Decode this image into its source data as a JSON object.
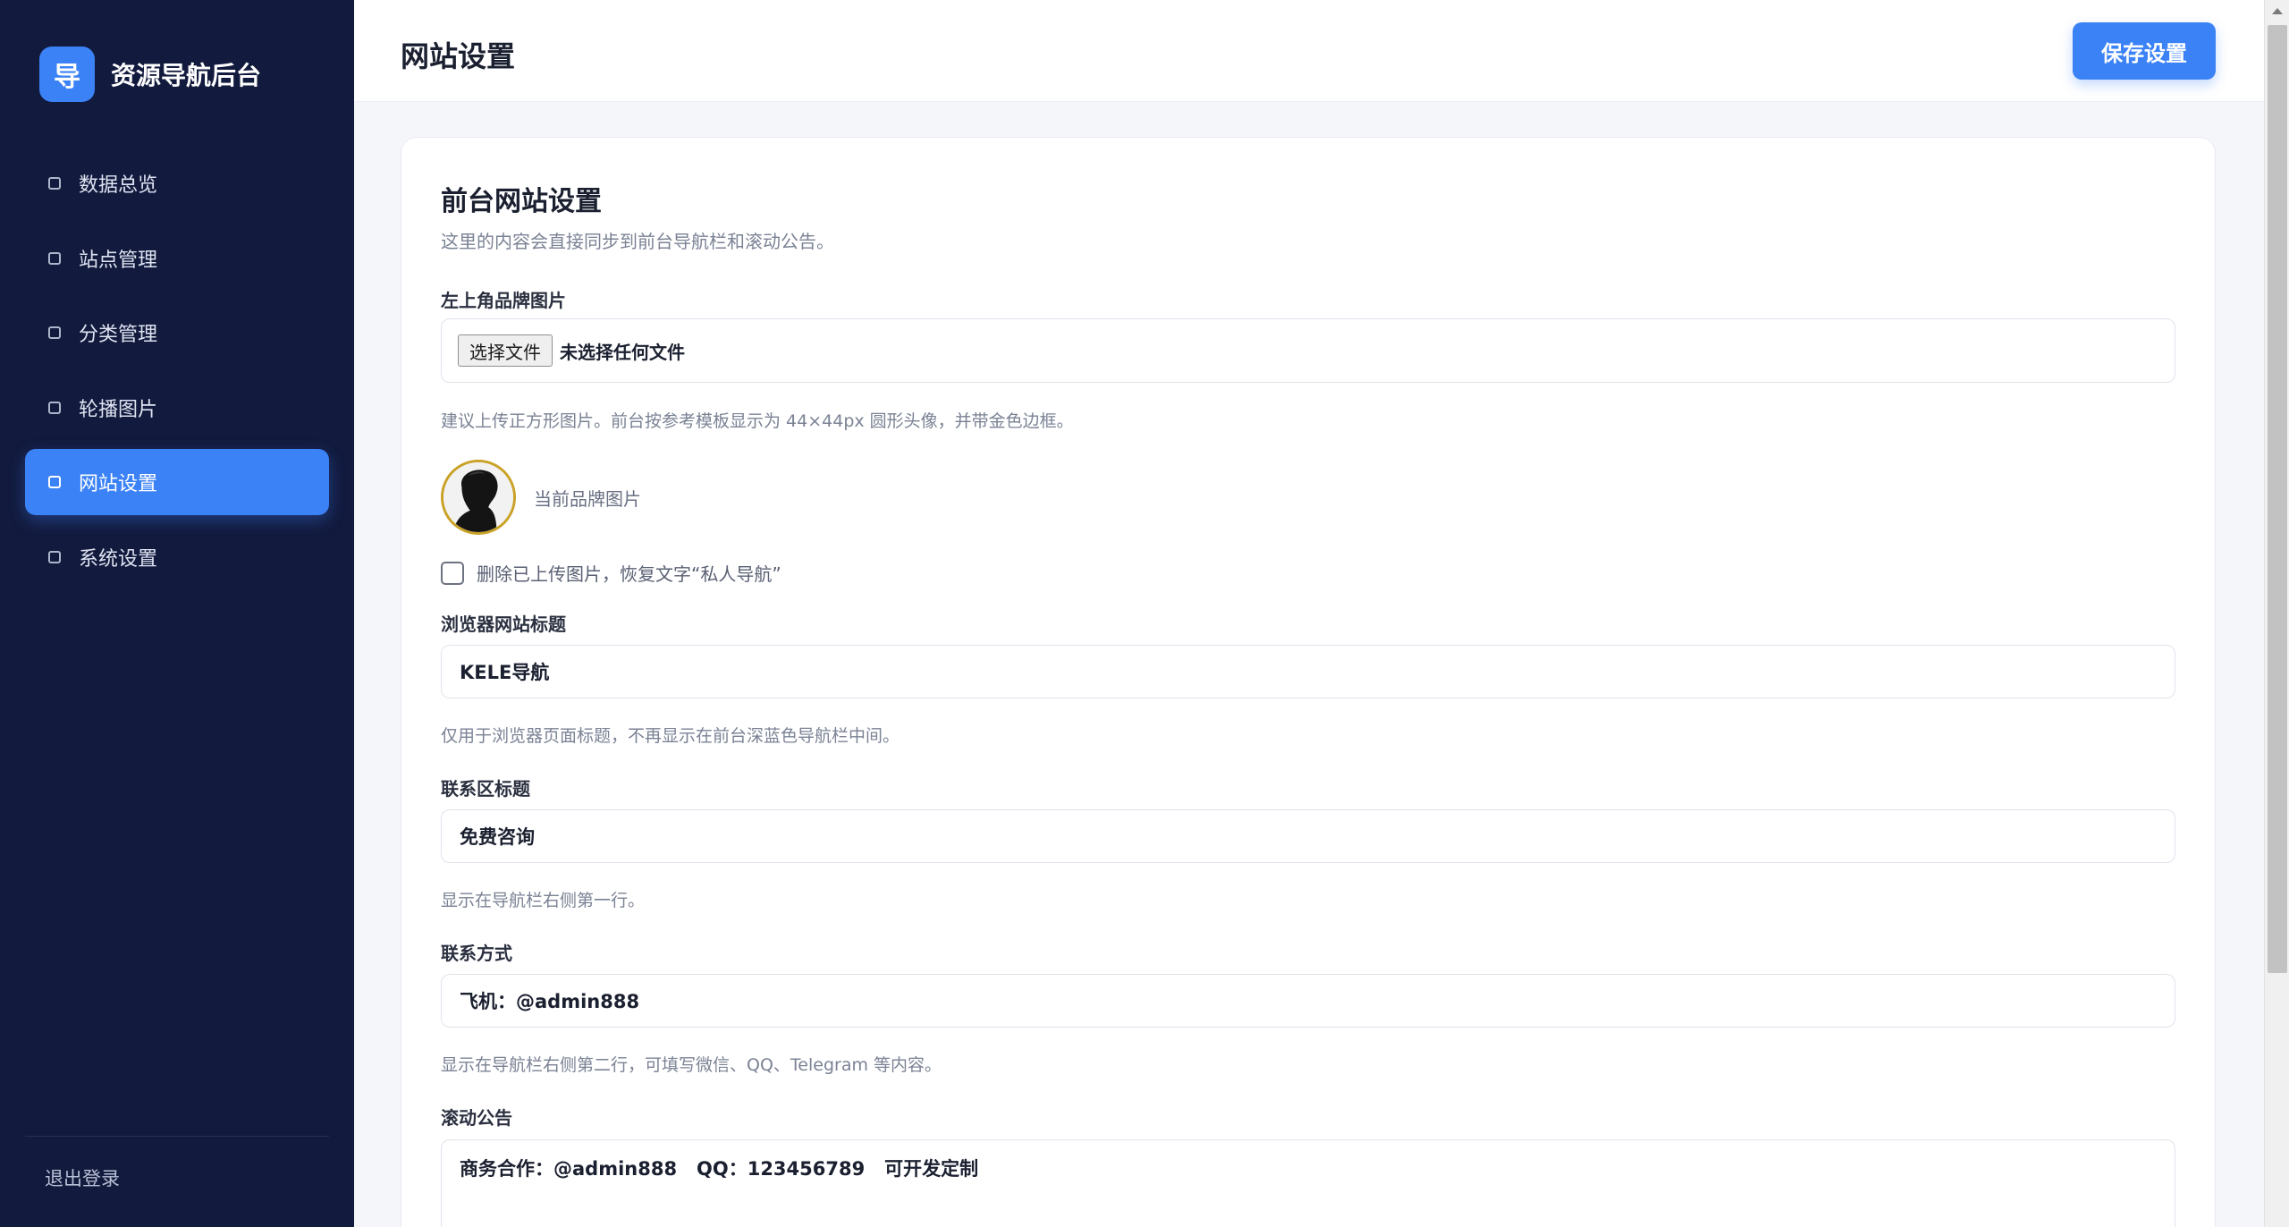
{
  "sidebar": {
    "logo_char": "导",
    "app_name": "资源导航后台",
    "items": [
      {
        "label": "数据总览"
      },
      {
        "label": "站点管理"
      },
      {
        "label": "分类管理"
      },
      {
        "label": "轮播图片"
      },
      {
        "label": "网站设置",
        "active": true
      },
      {
        "label": "系统设置"
      }
    ],
    "logout_label": "退出登录"
  },
  "header": {
    "title": "网站设置",
    "save_label": "保存设置"
  },
  "form": {
    "section_title": "前台网站设置",
    "section_desc": "这里的内容会直接同步到前台导航栏和滚动公告。",
    "brand_image": {
      "label": "左上角品牌图片",
      "choose_label": "选择文件",
      "status": "未选择任何文件",
      "hint": "建议上传正方形图片。前台按参考模板显示为 44×44px 圆形头像，并带金色边框。",
      "current_caption": "当前品牌图片",
      "remove_label": "删除已上传图片，恢复文字“私人导航”"
    },
    "browser_title": {
      "label": "浏览器网站标题",
      "value": "KELE导航",
      "hint": "仅用于浏览器页面标题，不再显示在前台深蓝色导航栏中间。"
    },
    "contact_title": {
      "label": "联系区标题",
      "value": "免费咨询",
      "hint": "显示在导航栏右侧第一行。"
    },
    "contact_method": {
      "label": "联系方式",
      "value": "飞机：@admin888",
      "hint": "显示在导航栏右侧第二行，可填写微信、QQ、Telegram 等内容。"
    },
    "marquee": {
      "label": "滚动公告",
      "value": "商务合作：@admin888   QQ：123456789   可开发定制"
    }
  },
  "colors": {
    "sidebar_bg": "#121a3d",
    "accent": "#3b82f6",
    "avatar_border": "#c9a227"
  }
}
